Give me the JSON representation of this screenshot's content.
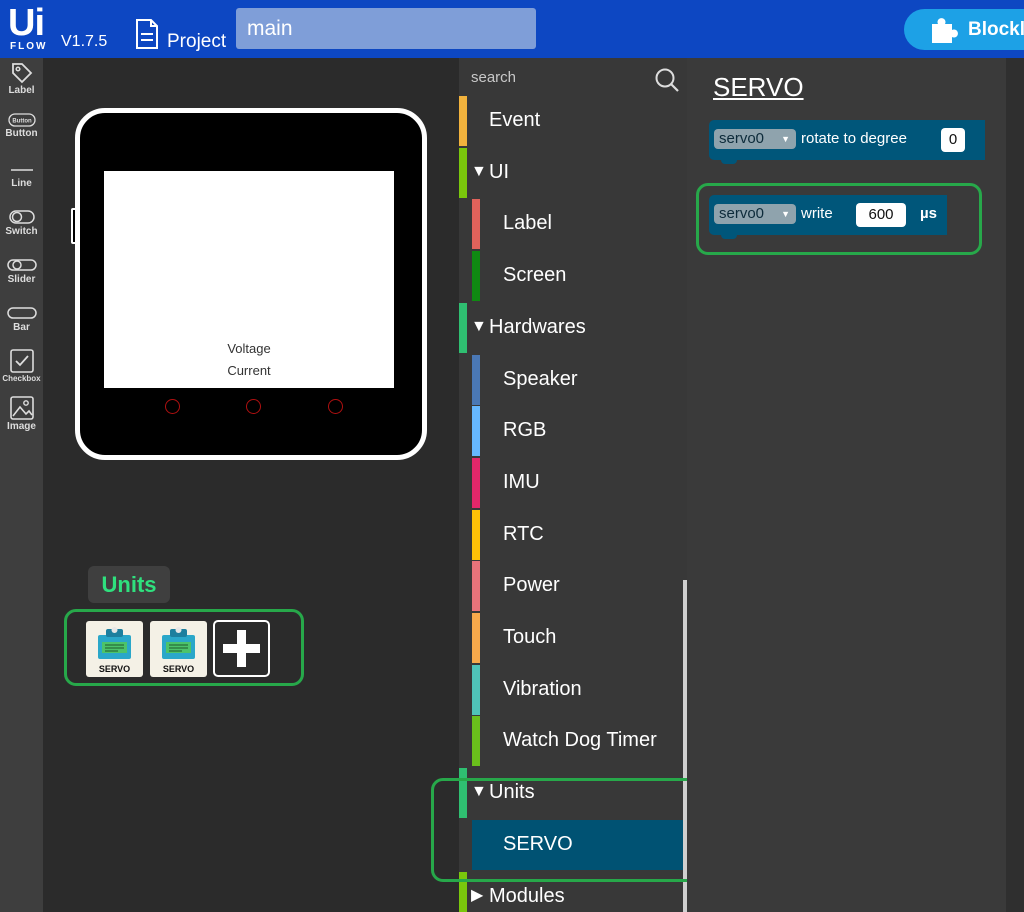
{
  "app": {
    "logo_top": "Ui",
    "logo_bottom": "FLOW",
    "version": "V1.7.5",
    "project_label": "Project",
    "project_name": "main",
    "mode_button": "Blockly"
  },
  "widgets": [
    {
      "name": "Label",
      "icon": "tag-icon"
    },
    {
      "name": "Button",
      "icon": "button-icon",
      "icon_text": "Button"
    },
    {
      "name": "Line",
      "icon": "line-icon"
    },
    {
      "name": "Switch",
      "icon": "switch-icon"
    },
    {
      "name": "Slider",
      "icon": "slider-icon"
    },
    {
      "name": "Bar",
      "icon": "bar-icon"
    },
    {
      "name": "Checkbox",
      "icon": "checkbox-icon"
    },
    {
      "name": "Image",
      "icon": "image-icon"
    }
  ],
  "device": {
    "screen_lines": [
      "Voltage",
      "Current"
    ]
  },
  "units_panel": {
    "title": "Units",
    "tiles": [
      {
        "label": "SERVO"
      },
      {
        "label": "SERVO"
      }
    ],
    "add_icon": "plus-icon"
  },
  "categories": {
    "search_placeholder": "search",
    "items": [
      {
        "label": "Event",
        "kind": "top",
        "color": "#f2b33d"
      },
      {
        "label": "UI",
        "kind": "group",
        "arrow": "▼",
        "color": "#7ac70c"
      },
      {
        "label": "Label",
        "kind": "sub",
        "color": "#e0625b"
      },
      {
        "label": "Screen",
        "kind": "sub",
        "color": "#0f8a12"
      },
      {
        "label": "Hardwares",
        "kind": "group",
        "arrow": "▼",
        "color": "#2fbf71"
      },
      {
        "label": "Speaker",
        "kind": "sub",
        "color": "#4a78b5"
      },
      {
        "label": "RGB",
        "kind": "sub",
        "color": "#66b8ff"
      },
      {
        "label": "IMU",
        "kind": "sub",
        "color": "#e3276a"
      },
      {
        "label": "RTC",
        "kind": "sub",
        "color": "#ffc107"
      },
      {
        "label": "Power",
        "kind": "sub",
        "color": "#e8737a"
      },
      {
        "label": "Touch",
        "kind": "sub",
        "color": "#f7a94b"
      },
      {
        "label": "Vibration",
        "kind": "sub",
        "color": "#4fc3b8"
      },
      {
        "label": "Watch Dog Timer",
        "kind": "sub",
        "color": "#6abf1c"
      },
      {
        "label": "Units",
        "kind": "group",
        "arrow": "▼",
        "color": "#2fbf71"
      },
      {
        "label": "SERVO",
        "kind": "sub",
        "color": "#005273",
        "selected": true
      },
      {
        "label": "Modules",
        "kind": "group",
        "arrow": "▶",
        "color": "#7ac70c"
      }
    ]
  },
  "workspace": {
    "title": "SERVO",
    "blocks": [
      {
        "device": "servo0",
        "text": "rotate to degree",
        "value": "0",
        "unit": ""
      },
      {
        "device": "servo0",
        "text": "write",
        "value": "600",
        "unit": "µs"
      }
    ]
  },
  "colors": {
    "topbar": "#0d47c2",
    "block": "#00567a",
    "highlight": "#27a84a",
    "units_tag_text": "#2fe07e"
  }
}
